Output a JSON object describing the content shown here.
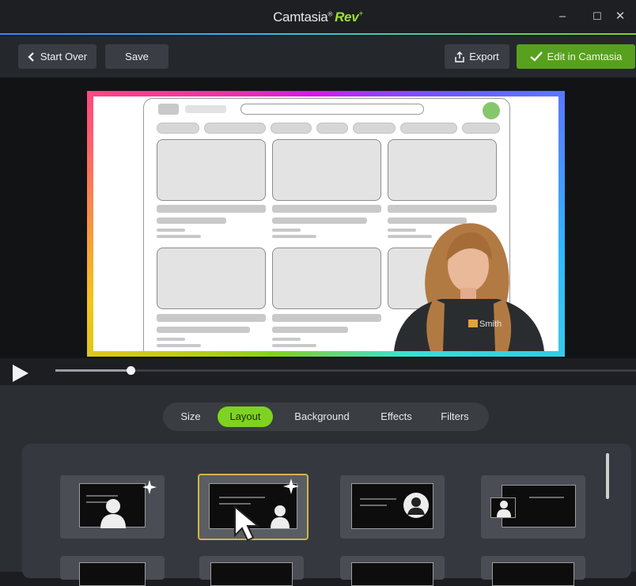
{
  "titlebar": {
    "app_name": "Camtasia",
    "registered": "®",
    "brand": "Rev",
    "brand_mark": "+",
    "controls": {
      "minimize": "–",
      "maximize": "☐",
      "close": "✕"
    }
  },
  "toolbar": {
    "start_over_label": "Start Over",
    "save_label": "Save",
    "export_label": "Export",
    "edit_label": "Edit in Camtasia"
  },
  "preview": {
    "frame_gradient": [
      "#7ed321",
      "#f5c518",
      "#ff3d8b",
      "#d41ae6",
      "#6a5cff",
      "#2fb9ff",
      "#3fe0d0"
    ],
    "shirt_text": "Smith"
  },
  "playback": {
    "progress": 0.13
  },
  "tabs": [
    {
      "label": "Size",
      "active": false
    },
    {
      "label": "Layout",
      "active": true
    },
    {
      "label": "Background",
      "active": false
    },
    {
      "label": "Effects",
      "active": false
    },
    {
      "label": "Filters",
      "active": false
    }
  ],
  "layouts": [
    {
      "name": "layout-camera-center",
      "selected": false
    },
    {
      "name": "layout-camera-bottom-right",
      "selected": true
    },
    {
      "name": "layout-camera-circle-right",
      "selected": false
    },
    {
      "name": "layout-camera-left-inset",
      "selected": false
    }
  ],
  "colors": {
    "accent": "#7ed321",
    "edit_button": "#57a11e",
    "selected_border": "#d6b24a"
  }
}
